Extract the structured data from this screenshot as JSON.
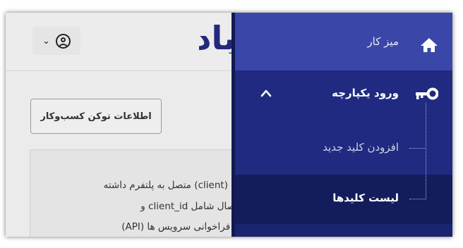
{
  "header": {
    "logo_text": "باد",
    "user_menu": {
      "avatar_icon": "user-circle-icon",
      "chevron_icon": "chevron-down-icon",
      "chevron_glyph": "⌄"
    }
  },
  "main": {
    "token_button_label": "اطلاعات توکن کسب‌وکار",
    "info_text": [
      "کشن (client) متصل به پلتفرم داشته",
      "ید اتصال شامل client_id و",
      "برای فراخوانی سرویس ها (API)"
    ]
  },
  "sidebar": {
    "items": [
      {
        "label": "میز کار",
        "icon": "home-icon"
      },
      {
        "label": "ورود یکپارچه",
        "icon": "key-icon",
        "expanded": true,
        "chevron_icon": "chevron-up-icon"
      },
      {
        "label": "افزودن کلید جدید"
      },
      {
        "label": "لیست کلیدها",
        "active": true
      }
    ]
  },
  "colors": {
    "sidebar_bg": "#1a2570",
    "sidebar_active_top": "#3a47a9",
    "sidebar_selected": "#141d5c",
    "logo": "#23297a"
  }
}
